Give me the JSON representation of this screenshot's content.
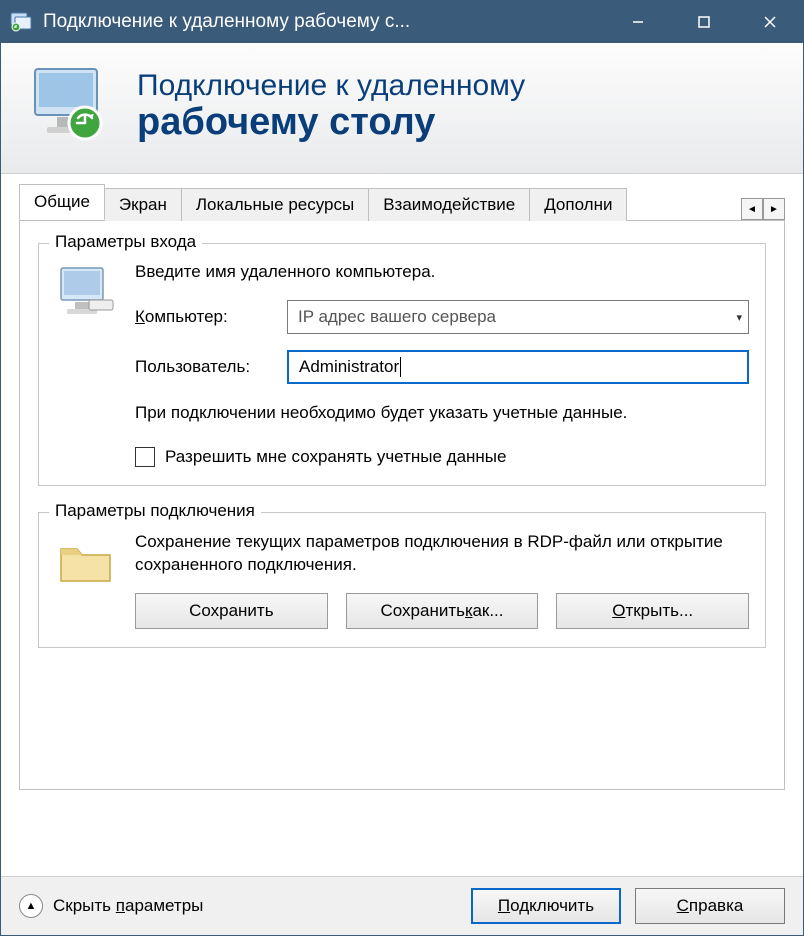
{
  "titlebar": {
    "title": "Подключение к удаленному рабочему с..."
  },
  "header": {
    "line1": "Подключение к удаленному",
    "line2": "рабочему столу"
  },
  "tabs": {
    "items": [
      {
        "label": "Общие",
        "active": true
      },
      {
        "label": "Экран"
      },
      {
        "label": "Локальные ресурсы"
      },
      {
        "label": "Взаимодействие"
      },
      {
        "label": "Дополни"
      }
    ]
  },
  "login_group": {
    "legend": "Параметры входа",
    "instruction": "Введите имя удаленного компьютера.",
    "computer_label_pre": "К",
    "computer_label_rest": "омпьютер:",
    "computer_value": "IP адрес вашего сервера",
    "user_label": "Пользователь:",
    "user_value": "Administrator",
    "note": "При подключении необходимо будет указать учетные данные.",
    "checkbox_pre": "Р",
    "checkbox_rest": "азрешить мне сохранять учетные данные"
  },
  "conn_group": {
    "legend": "Параметры подключения",
    "text": "Сохранение текущих параметров подключения в RDP-файл или открытие сохраненного подключения.",
    "save_label": "Сохранить",
    "saveas_label_pre": "Сохранить ",
    "saveas_label_u": "к",
    "saveas_label_post": "ак...",
    "open_label_pre": "О",
    "open_label_rest": "ткрыть..."
  },
  "footer": {
    "hide_pre": "Скрыть ",
    "hide_u": "п",
    "hide_post": "араметры",
    "connect_pre": "П",
    "connect_rest": "одключить",
    "help_pre": "С",
    "help_rest": "правка"
  }
}
